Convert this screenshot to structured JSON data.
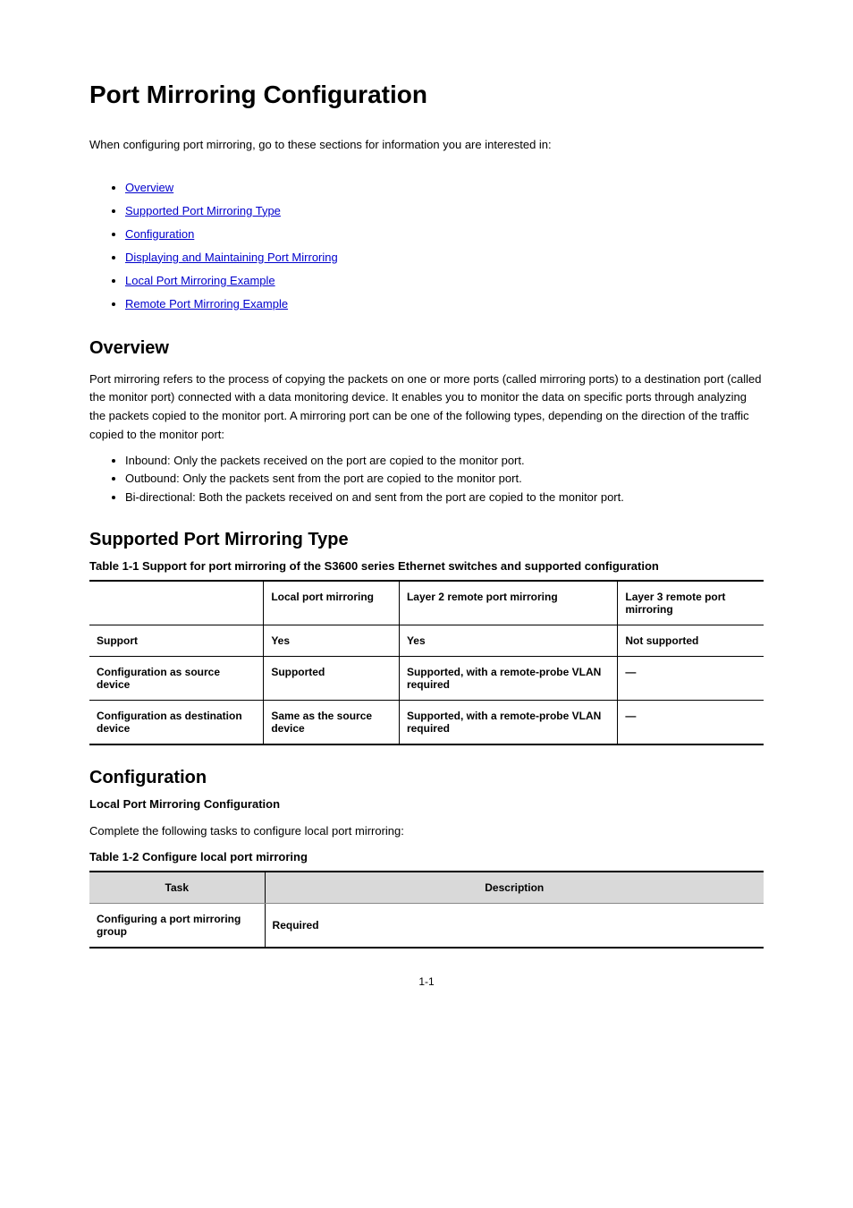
{
  "title": "Port Mirroring Configuration",
  "intro": "When configuring port mirroring, go to these sections for information you are interested in:",
  "toc": [
    "Overview",
    "Supported Port Mirroring Type",
    "Configuration",
    "Displaying and Maintaining Port Mirroring",
    "Local Port Mirroring Example",
    "Remote Port Mirroring Example"
  ],
  "overview_p1": "Port mirroring refers to the process of copying the packets on one or more ports (called mirroring ports) to a destination port (called the monitor port) connected with a data monitoring device. It enables you to monitor the data on specific ports through analyzing the packets copied to the monitor port. A mirroring port can be one of the following types, depending on the direction of the traffic copied to the monitor port:",
  "overview_bullets": [
    "Inbound: Only the packets received on the port are copied to the monitor port.",
    "Outbound: Only the packets sent from the port are copied to the monitor port.",
    "Bi-directional: Both the packets received on and sent from the port are copied to the monitor port."
  ],
  "supported_heading": "Supported Port Mirroring Type",
  "table1_caption": "Table 1-1 Support for port mirroring of the S3600 series Ethernet switches and supported configuration",
  "table1": {
    "headers": [
      "",
      "Local port mirroring",
      "Layer 2 remote port mirroring",
      "Layer 3 remote port mirroring"
    ],
    "rows": [
      [
        "Support",
        "Yes",
        "Yes",
        "Not supported"
      ],
      [
        "Configuration as source device",
        "Supported",
        "Supported, with a remote-probe VLAN required",
        "—"
      ],
      [
        "Configuration as destination device",
        "Same as the source device",
        "Supported, with a remote-probe VLAN required",
        "—"
      ]
    ]
  },
  "config_heading": "Configuration",
  "config_subheading": "Local Port Mirroring Configuration",
  "config_para": "Complete the following tasks to configure local port mirroring:",
  "table2_caption": "Table 1-2 Configure local port mirroring",
  "table2": {
    "headers": [
      "Task",
      "Description"
    ],
    "rows": [
      [
        "Configuring a port mirroring group",
        "Required"
      ]
    ]
  },
  "page_number": "1-1"
}
